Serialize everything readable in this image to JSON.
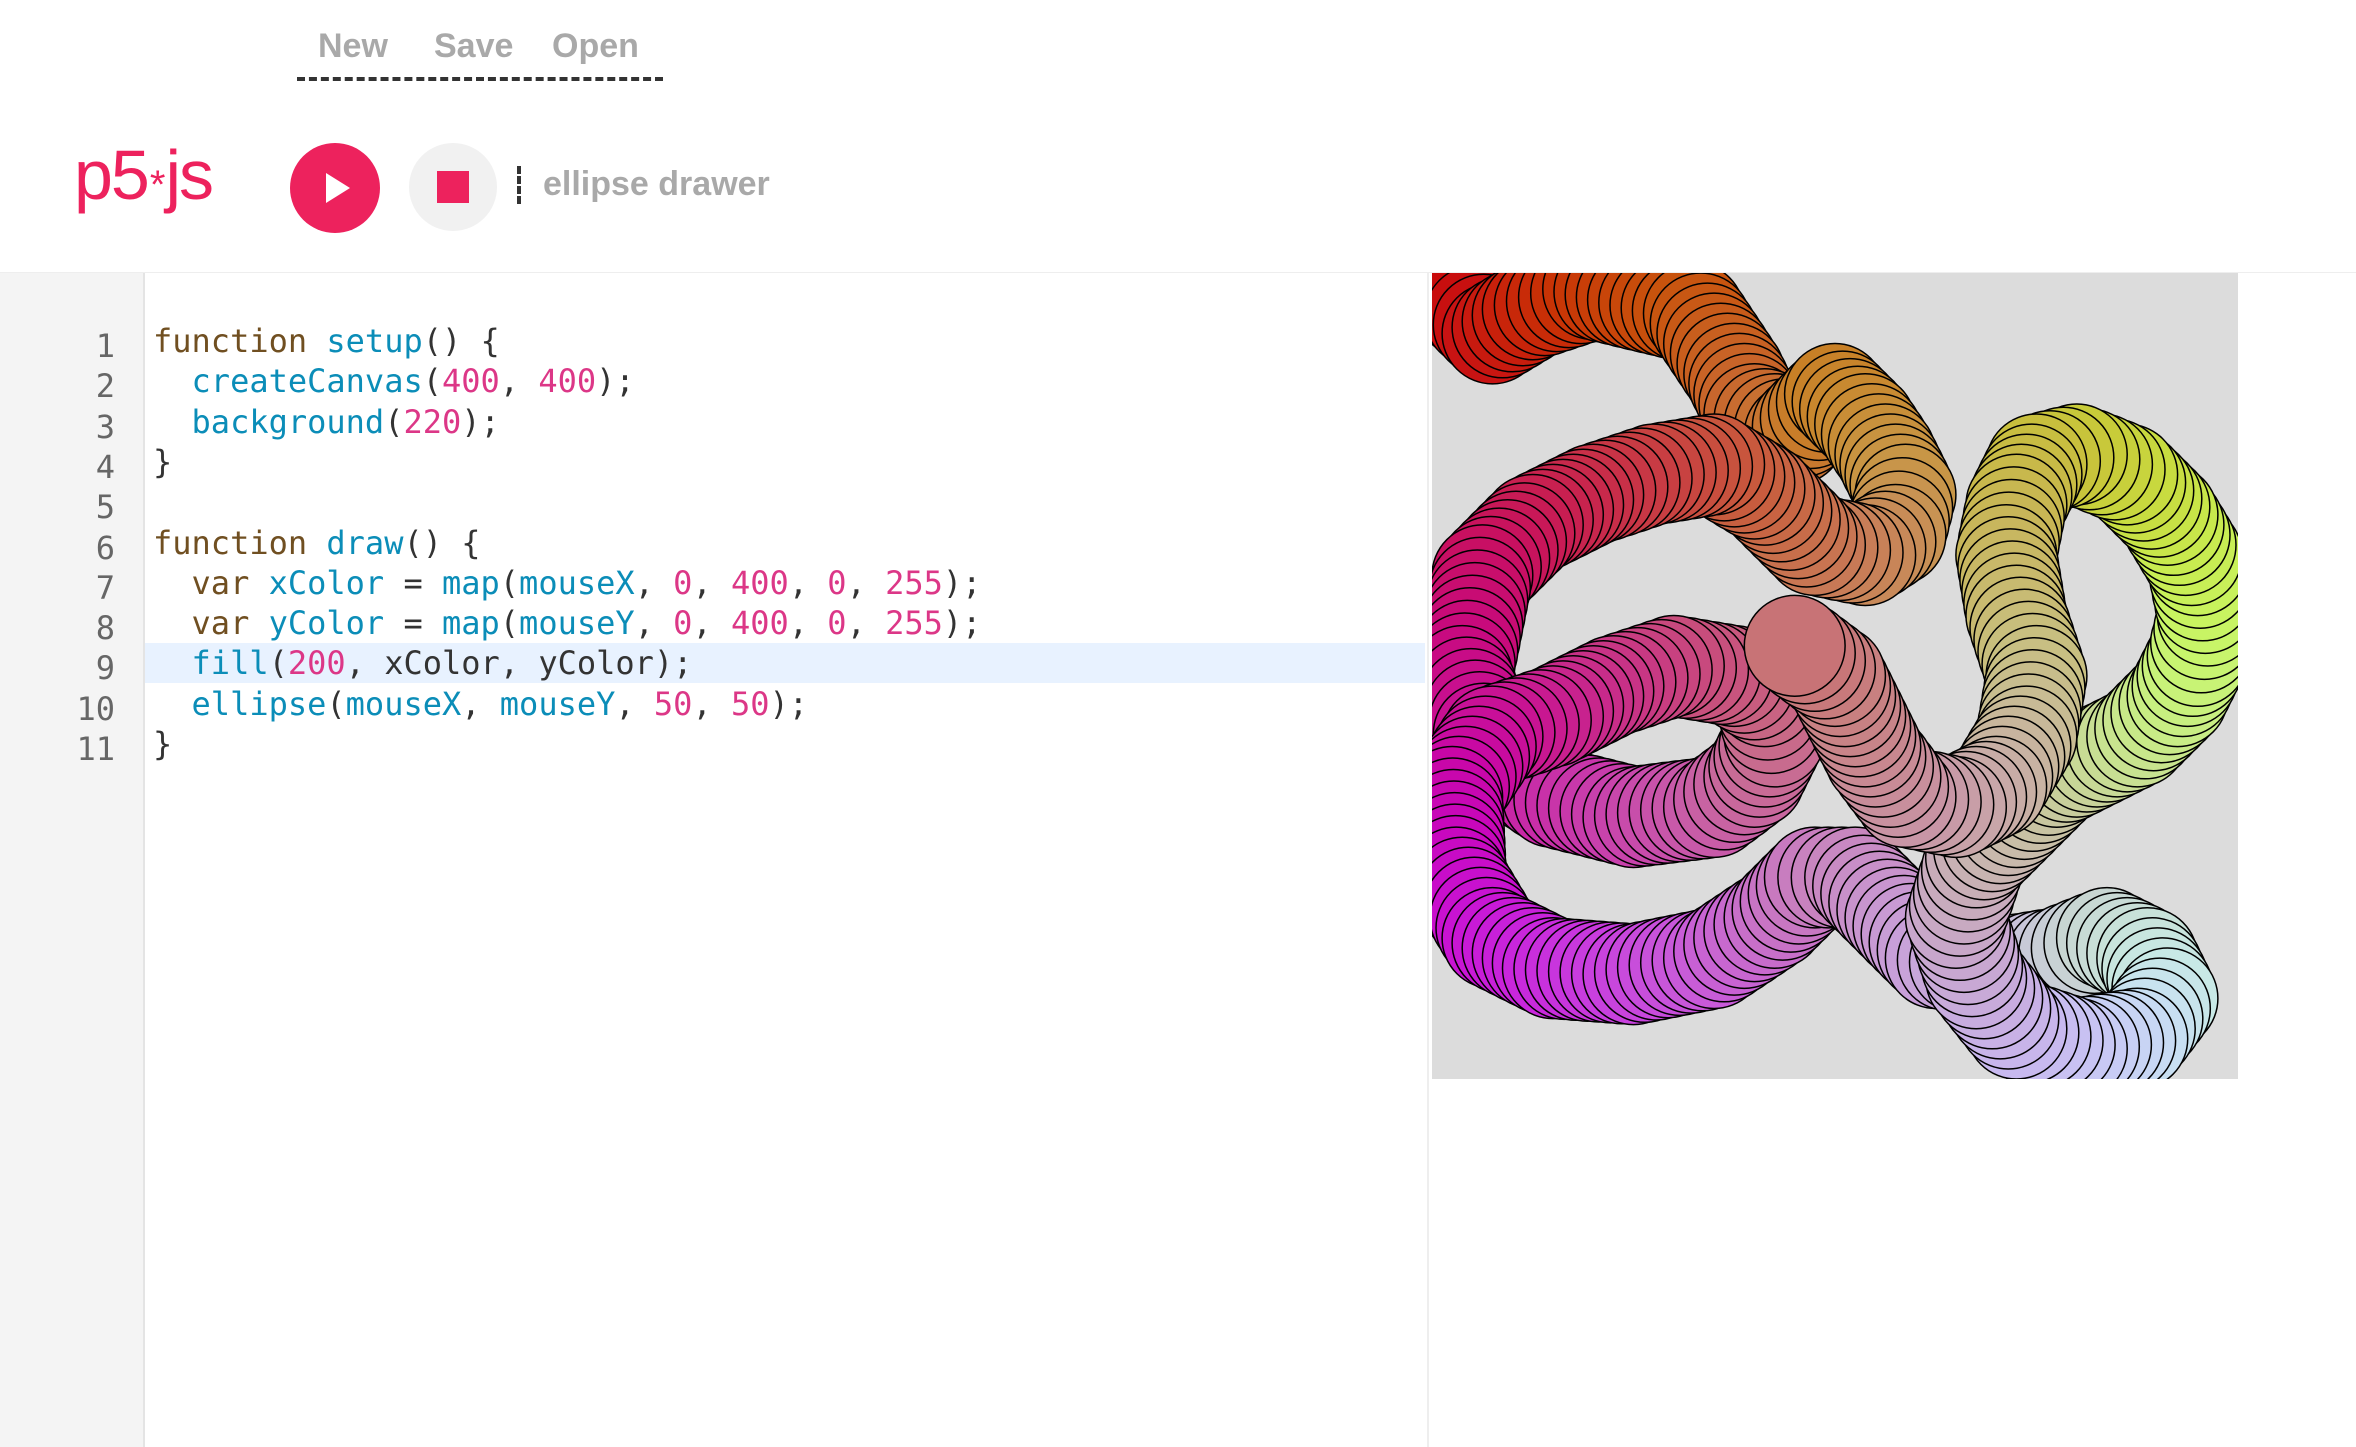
{
  "menu": {
    "new_label": "New",
    "save_label": "Save",
    "open_label": "Open"
  },
  "toolbar": {
    "logo_text": "p5",
    "logo_star": "*",
    "logo_suffix": "js",
    "sketch_name": "ellipse drawer"
  },
  "colors": {
    "accent": "#ed225d",
    "keyword": "#704f21",
    "function": "#0b8db8",
    "number": "#dc3787"
  },
  "editor": {
    "highlighted_line": 9,
    "lines": [
      {
        "n": "1",
        "tokens": [
          [
            "kw",
            "function "
          ],
          [
            "fn",
            "setup"
          ],
          [
            "pl",
            "() {"
          ]
        ]
      },
      {
        "n": "2",
        "tokens": [
          [
            "pl",
            "  "
          ],
          [
            "fn",
            "createCanvas"
          ],
          [
            "pl",
            "("
          ],
          [
            "num",
            "400"
          ],
          [
            "pl",
            ", "
          ],
          [
            "num",
            "400"
          ],
          [
            "pl",
            ");"
          ]
        ]
      },
      {
        "n": "3",
        "tokens": [
          [
            "pl",
            "  "
          ],
          [
            "fn",
            "background"
          ],
          [
            "pl",
            "("
          ],
          [
            "num",
            "220"
          ],
          [
            "pl",
            ");"
          ]
        ]
      },
      {
        "n": "4",
        "tokens": [
          [
            "pl",
            "}"
          ]
        ]
      },
      {
        "n": "5",
        "tokens": []
      },
      {
        "n": "6",
        "tokens": [
          [
            "kw",
            "function "
          ],
          [
            "fn",
            "draw"
          ],
          [
            "pl",
            "() {"
          ]
        ]
      },
      {
        "n": "7",
        "tokens": [
          [
            "pl",
            "  "
          ],
          [
            "kw",
            "var "
          ],
          [
            "fn",
            "xColor"
          ],
          [
            "pl",
            " = "
          ],
          [
            "fn",
            "map"
          ],
          [
            "pl",
            "("
          ],
          [
            "fn",
            "mouseX"
          ],
          [
            "pl",
            ", "
          ],
          [
            "num",
            "0"
          ],
          [
            "pl",
            ", "
          ],
          [
            "num",
            "400"
          ],
          [
            "pl",
            ", "
          ],
          [
            "num",
            "0"
          ],
          [
            "pl",
            ", "
          ],
          [
            "num",
            "255"
          ],
          [
            "pl",
            ");"
          ]
        ]
      },
      {
        "n": "8",
        "tokens": [
          [
            "pl",
            "  "
          ],
          [
            "kw",
            "var "
          ],
          [
            "fn",
            "yColor"
          ],
          [
            "pl",
            " = "
          ],
          [
            "fn",
            "map"
          ],
          [
            "pl",
            "("
          ],
          [
            "fn",
            "mouseY"
          ],
          [
            "pl",
            ", "
          ],
          [
            "num",
            "0"
          ],
          [
            "pl",
            ", "
          ],
          [
            "num",
            "400"
          ],
          [
            "pl",
            ", "
          ],
          [
            "num",
            "0"
          ],
          [
            "pl",
            ", "
          ],
          [
            "num",
            "255"
          ],
          [
            "pl",
            ");"
          ]
        ]
      },
      {
        "n": "9",
        "tokens": [
          [
            "pl",
            "  "
          ],
          [
            "fn",
            "fill"
          ],
          [
            "pl",
            "("
          ],
          [
            "num",
            "200"
          ],
          [
            "pl",
            ", xColor, yColor);"
          ]
        ]
      },
      {
        "n": "10",
        "tokens": [
          [
            "pl",
            "  "
          ],
          [
            "fn",
            "ellipse"
          ],
          [
            "pl",
            "("
          ],
          [
            "fn",
            "mouseX"
          ],
          [
            "pl",
            ", "
          ],
          [
            "fn",
            "mouseY"
          ],
          [
            "pl",
            ", "
          ],
          [
            "num",
            "50"
          ],
          [
            "pl",
            ", "
          ],
          [
            "num",
            "50"
          ],
          [
            "pl",
            ");"
          ]
        ]
      },
      {
        "n": "11",
        "tokens": [
          [
            "pl",
            "}"
          ]
        ]
      }
    ]
  }
}
